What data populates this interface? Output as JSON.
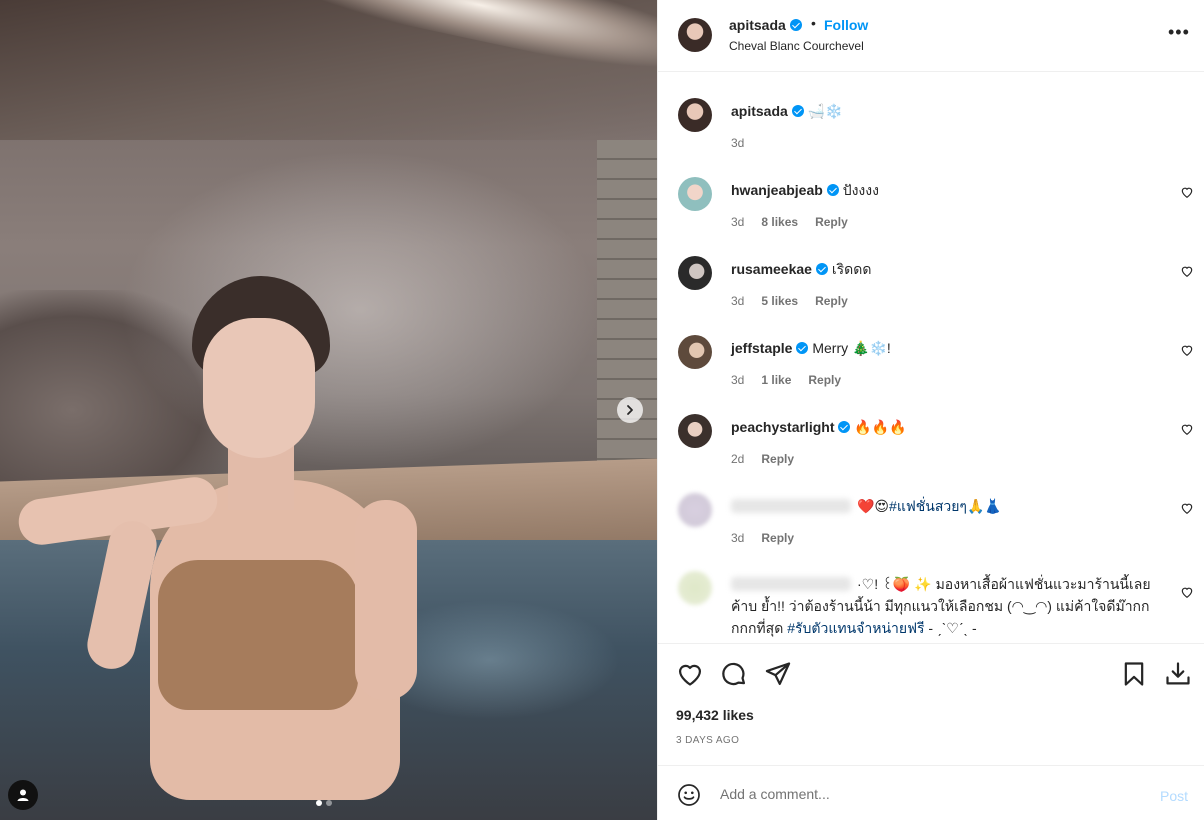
{
  "post": {
    "username": "apitsada",
    "follow_label": "Follow",
    "bullet": "•",
    "location": "Cheval Blanc Courchevel",
    "more_label": "•••"
  },
  "caption": {
    "username": "apitsada",
    "text": "🛁❄️",
    "time": "3d"
  },
  "comments": [
    {
      "username": "hwanjeabjeab",
      "text": "ปังงงง",
      "time": "3d",
      "likes": "8 likes",
      "reply": "Reply"
    },
    {
      "username": "rusameekae",
      "text": "เริดดด",
      "time": "3d",
      "likes": "5 likes",
      "reply": "Reply"
    },
    {
      "username": "jeffstaple",
      "text": "Merry 🎄❄️!",
      "time": "3d",
      "likes": "1 like",
      "reply": "Reply"
    },
    {
      "username": "peachystarlight",
      "text": "🔥🔥🔥",
      "time": "2d",
      "likes": "",
      "reply": "Reply"
    },
    {
      "username": "",
      "text": "❤️😍",
      "hashtag": "#แฟชั่นสวยๆ",
      "text_after": "🙏👗",
      "time": "3d",
      "likes": "",
      "reply": "Reply"
    },
    {
      "username": "",
      "text": "·♡! ꒰🍑 ✨ มองหาเสื้อผ้าแฟชั่นแวะมาร้านนี้เลยค้าบ ย้ำ!! ว่าต้องร้านนี้น้า มีทุกแนวให้เลือกชม (◠‿◠) แม่ค้าใจดีม๊ากกกกกที่สุด",
      "hashtag": "#รับตัวแทนจำหน่ายฟรี",
      "text_after": "- ˏˋ♡ˊˎ -"
    }
  ],
  "actions": {
    "likes": "99,432 likes",
    "ago": "3 DAYS AGO"
  },
  "add_comment": {
    "placeholder": "Add a comment...",
    "post_label": "Post"
  },
  "carousel": {
    "current": 1,
    "total": 2
  },
  "colors": {
    "accent": "#0095f6",
    "hashtag": "#00376b",
    "muted": "#737373"
  }
}
